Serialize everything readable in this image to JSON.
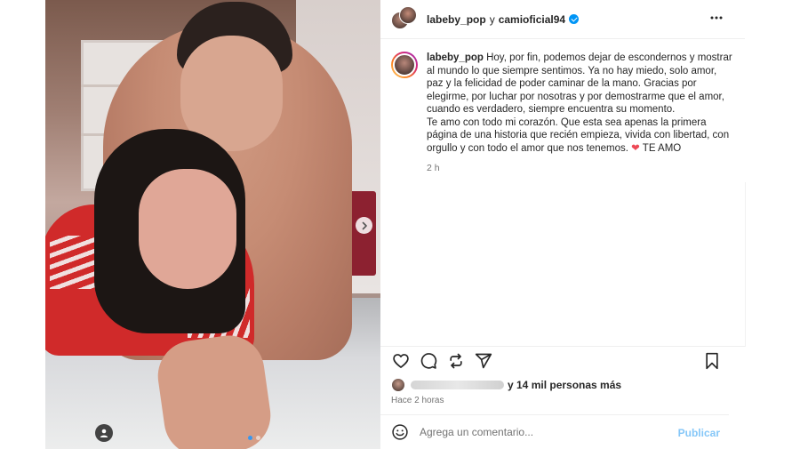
{
  "header": {
    "user1": "labeby_pop",
    "conjunction": "y",
    "user2": "camioficial94",
    "verified": true,
    "more_icon": "more-horizontal-icon"
  },
  "caption": {
    "username": "labeby_pop",
    "paragraph1": "Hoy, por fin, podemos dejar de escondernos y mostrar al mundo lo que siempre sentimos. Ya no hay miedo, solo amor, paz y la felicidad de poder caminar de la mano. Gracias por elegirme, por luchar por nosotras y por demostrarme que el amor, cuando es verdadero, siempre encuentra su momento.",
    "paragraph2": "Te amo con todo mi corazón. Que esta sea apenas la primera página de una historia que recién empieza, vivida con libertad, con orgullo y con todo el amor que nos tenemos.",
    "heart": "❤",
    "ending": "TE AMO",
    "time": "2 h"
  },
  "actions": {
    "like_icon": "heart-icon",
    "comment_icon": "comment-icon",
    "repost_icon": "repost-icon",
    "share_icon": "share-icon",
    "save_icon": "bookmark-icon"
  },
  "likes": {
    "text": "y 14 mil personas más"
  },
  "timeago": "Hace 2 horas",
  "comment": {
    "emoji_icon": "emoji-icon",
    "placeholder": "Agrega un comentario...",
    "post_label": "Publicar"
  },
  "carousel": {
    "slide_count": 2,
    "active_index": 0
  },
  "colors": {
    "accent": "#0095f6",
    "post_button": "#85c7f8",
    "heart": "#ed4956",
    "muted_text": "#737373"
  }
}
